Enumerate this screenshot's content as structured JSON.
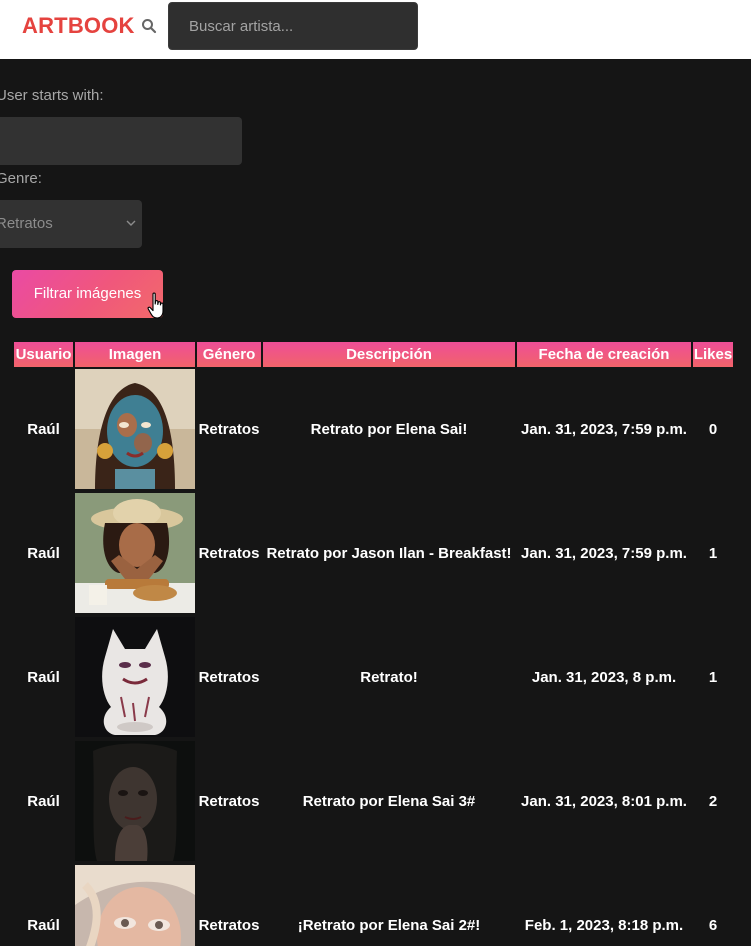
{
  "nav": {
    "brand": "ARTBOOK",
    "search_placeholder": "Buscar artista..."
  },
  "filters": {
    "user_label": "User starts with:",
    "user_value": "",
    "genre_label": "Genre:",
    "genre_selected": "Retratos",
    "submit_label": "Filtrar imágenes"
  },
  "table": {
    "headers": {
      "user": "Usuario",
      "image": "Imagen",
      "genre": "Género",
      "description": "Descripción",
      "created": "Fecha de creación",
      "likes": "Likes"
    },
    "rows": [
      {
        "user": "Raúl",
        "genre": "Retratos",
        "description": "Retrato por Elena Sai!",
        "created": "Jan. 31, 2023, 7:59 p.m.",
        "likes": "0"
      },
      {
        "user": "Raúl",
        "genre": "Retratos",
        "description": "Retrato por Jason Ilan - Breakfast!",
        "created": "Jan. 31, 2023, 7:59 p.m.",
        "likes": "1"
      },
      {
        "user": "Raúl",
        "genre": "Retratos",
        "description": "Retrato!",
        "created": "Jan. 31, 2023, 8 p.m.",
        "likes": "1"
      },
      {
        "user": "Raúl",
        "genre": "Retratos",
        "description": "Retrato por Elena Sai 3#",
        "created": "Jan. 31, 2023, 8:01 p.m.",
        "likes": "2"
      },
      {
        "user": "Raúl",
        "genre": "Retratos",
        "description": "¡Retrato por Elena Sai 2#!",
        "created": "Feb. 1, 2023, 8:18 p.m.",
        "likes": "6"
      }
    ]
  },
  "colors": {
    "brand": "#e5433f",
    "accent_start": "#ea4aa4",
    "accent_end": "#f26a6a",
    "background": "#151515"
  }
}
